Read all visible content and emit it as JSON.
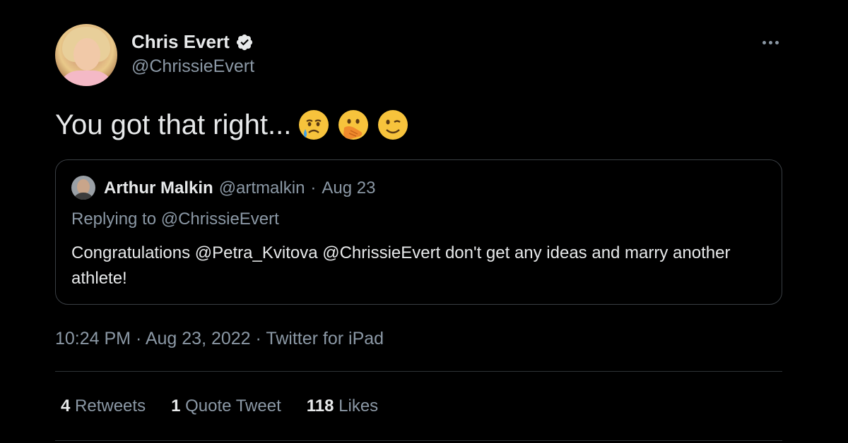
{
  "author": {
    "display_name": "Chris Evert",
    "handle": "@ChrissieEvert"
  },
  "tweet": {
    "text": "You got that right...",
    "emojis": [
      "crying-face-emoji",
      "face-with-hand-over-mouth-emoji",
      "winking-face-emoji"
    ]
  },
  "quoted": {
    "display_name": "Arthur Malkin",
    "handle": "@artmalkin",
    "separator": "·",
    "date": "Aug 23",
    "replying_to": "Replying to @ChrissieEvert",
    "text": "Congratulations @Petra_Kvitova @ChrissieEvert don't get any ideas and marry another athlete!"
  },
  "timestamp": "10:24 PM · Aug 23, 2022 · Twitter for iPad",
  "stats": [
    {
      "count": "4",
      "label": "Retweets"
    },
    {
      "count": "1",
      "label": "Quote Tweet"
    },
    {
      "count": "118",
      "label": "Likes"
    }
  ],
  "colors": {
    "background": "#000000",
    "text": "#e7e9ea",
    "muted": "#8b98a5",
    "border": "#2f3336",
    "verified_badge": "#e7e9ea"
  }
}
